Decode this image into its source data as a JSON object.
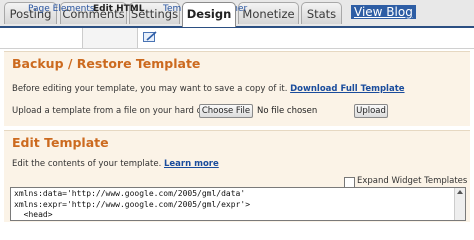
{
  "tabs": [
    {
      "label": "Posting",
      "active": false
    },
    {
      "label": "Comments",
      "active": false
    },
    {
      "label": "Settings",
      "active": false
    },
    {
      "label": "Design",
      "active": true
    },
    {
      "label": "Monetize",
      "active": false
    },
    {
      "label": "Stats",
      "active": false
    }
  ],
  "view_blog": "View Blog",
  "subnav": {
    "page_elements": "Page Elements",
    "edit_html": "Edit HTML",
    "template_designer": "Template Designer"
  },
  "backup": {
    "title": "Backup / Restore Template",
    "before_text": "Before editing your template, you may want to save a copy of it.",
    "download_link": "Download Full Template",
    "upload_text": "Upload a template from a file on your hard drive:",
    "choose_file": "Choose File",
    "no_file": "No file chosen",
    "upload_button": "Upload"
  },
  "edit": {
    "title": "Edit Template",
    "desc": "Edit the contents of your template.",
    "learn_more": "Learn more",
    "expand_label": "Expand Widget Templates",
    "code_lines": [
      "xmlns:data='http://www.google.com/2005/gml/data'",
      "xmlns:expr='http://www.google.com/2005/gml/expr'>",
      "  <head>"
    ]
  },
  "colors": {
    "accent": "#cc6a1f",
    "link": "#1a4c9c",
    "panel": "#fbf3e7",
    "navbar": "#2b4f82"
  }
}
